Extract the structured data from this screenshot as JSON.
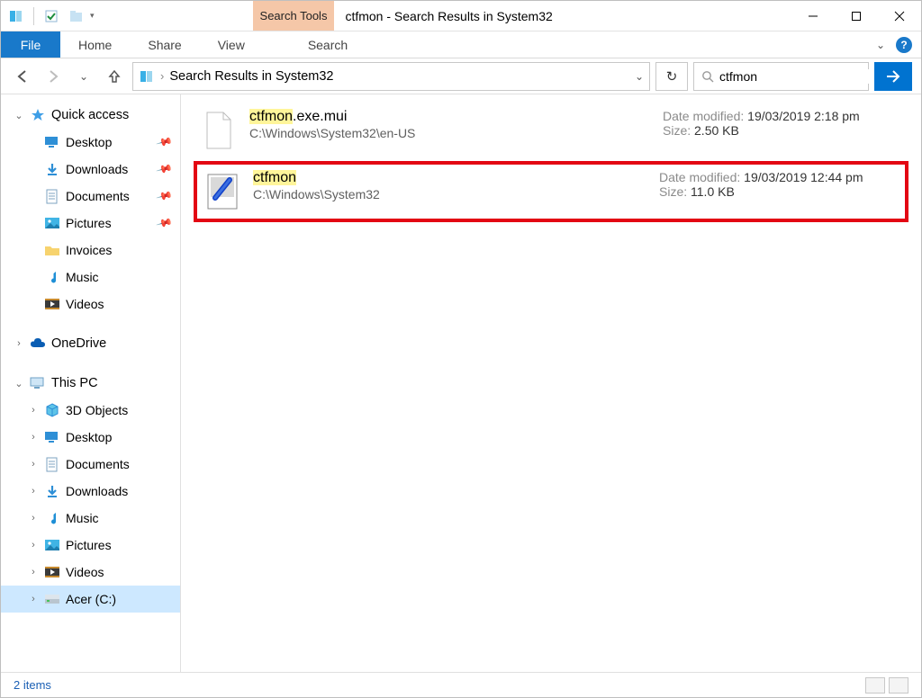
{
  "title": "ctfmon - Search Results in System32",
  "ribbon": {
    "tools_label": "Search Tools",
    "file": "File",
    "tabs": [
      "Home",
      "Share",
      "View",
      "Search"
    ]
  },
  "address": {
    "location": "Search Results in System32"
  },
  "search": {
    "value": "ctfmon"
  },
  "sidebar": {
    "quick_access": {
      "label": "Quick access",
      "expanded": true
    },
    "quick_items": [
      {
        "label": "Desktop",
        "icon": "desktop",
        "pinned": true
      },
      {
        "label": "Downloads",
        "icon": "downloads",
        "pinned": true
      },
      {
        "label": "Documents",
        "icon": "documents",
        "pinned": true
      },
      {
        "label": "Pictures",
        "icon": "pictures",
        "pinned": true
      },
      {
        "label": "Invoices",
        "icon": "folder",
        "pinned": false
      },
      {
        "label": "Music",
        "icon": "music",
        "pinned": false
      },
      {
        "label": "Videos",
        "icon": "videos",
        "pinned": false
      }
    ],
    "onedrive": {
      "label": "OneDrive"
    },
    "this_pc": {
      "label": "This PC",
      "expanded": true
    },
    "pc_items": [
      {
        "label": "3D Objects",
        "icon": "3d"
      },
      {
        "label": "Desktop",
        "icon": "desktop"
      },
      {
        "label": "Documents",
        "icon": "documents"
      },
      {
        "label": "Downloads",
        "icon": "downloads"
      },
      {
        "label": "Music",
        "icon": "music"
      },
      {
        "label": "Pictures",
        "icon": "pictures"
      },
      {
        "label": "Videos",
        "icon": "videos"
      },
      {
        "label": "Acer (C:)",
        "icon": "drive",
        "selected": true
      }
    ]
  },
  "labels": {
    "date_modified": "Date modified:",
    "size": "Size:"
  },
  "results": [
    {
      "name_hl": "ctfmon",
      "name_rest": ".exe.mui",
      "path": "C:\\Windows\\System32\\en-US",
      "date": "19/03/2019 2:18 pm",
      "size": "2.50 KB",
      "icon": "file",
      "highlighted": false
    },
    {
      "name_hl": "ctfmon",
      "name_rest": "",
      "path": "C:\\Windows\\System32",
      "date": "19/03/2019 12:44 pm",
      "size": "11.0 KB",
      "icon": "exe",
      "highlighted": true
    }
  ],
  "status": {
    "text": "2 items"
  }
}
